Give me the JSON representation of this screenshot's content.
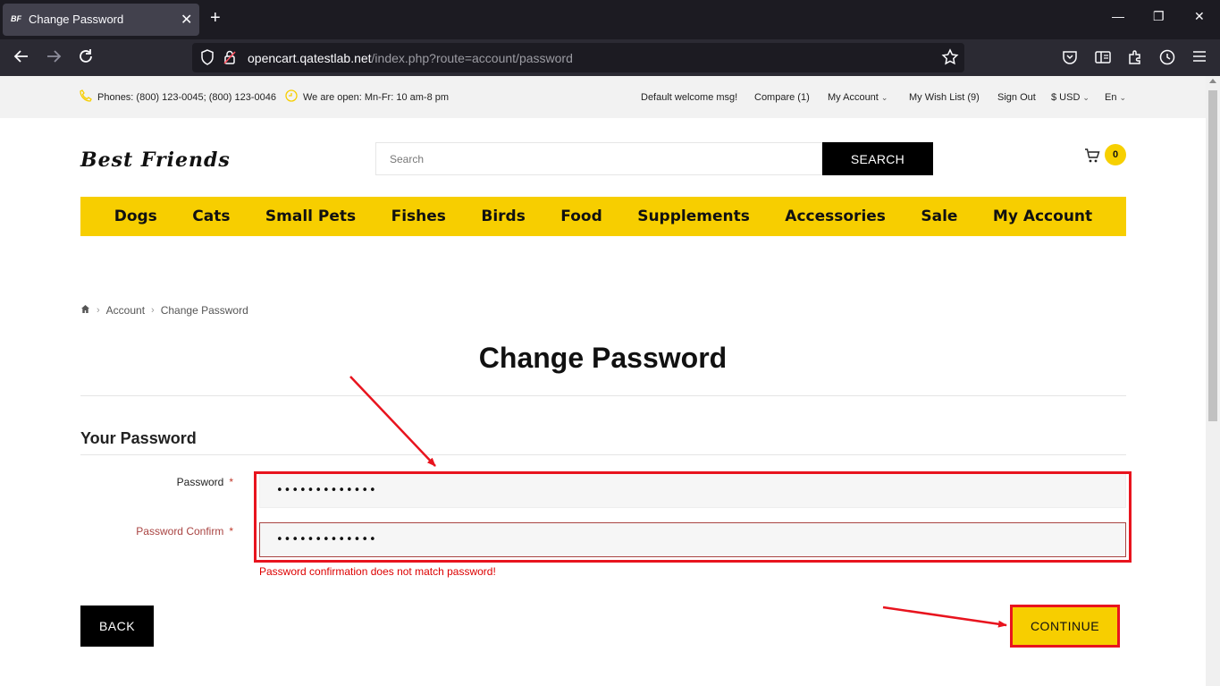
{
  "browser": {
    "tab_title": "Change Password",
    "tab_favicon": "BF",
    "url_host": "opencart.qatestlab.net",
    "url_path": "/index.php?route=account/password"
  },
  "topbar": {
    "phones": "Phones: (800) 123-0045; (800) 123-0046",
    "hours": "We are open: Mn-Fr: 10 am-8 pm",
    "welcome": "Default welcome msg!",
    "compare": "Compare (1)",
    "my_account": "My Account",
    "wishlist": "My Wish List (9)",
    "sign_out": "Sign Out",
    "currency": "$ USD",
    "language": "En"
  },
  "header": {
    "logo": "Best Friends",
    "search_placeholder": "Search",
    "search_button": "SEARCH",
    "cart_count": "0"
  },
  "menu": [
    "Dogs",
    "Cats",
    "Small Pets",
    "Fishes",
    "Birds",
    "Food",
    "Supplements",
    "Accessories",
    "Sale",
    "My Account"
  ],
  "breadcrumb": [
    "Account",
    "Change Password"
  ],
  "page": {
    "title": "Change Password",
    "section_title": "Your Password",
    "password_label": "Password",
    "password_value": "•••••••••••••",
    "confirm_label": "Password Confirm",
    "confirm_value": "•••••••••••••",
    "error": "Password confirmation does not match password!",
    "back_button": "BACK",
    "continue_button": "CONTINUE",
    "required_mark": "*"
  },
  "colors": {
    "accent_yellow": "#f7ce00",
    "annotation_red": "#e8141e",
    "error_red": "#a94442"
  }
}
